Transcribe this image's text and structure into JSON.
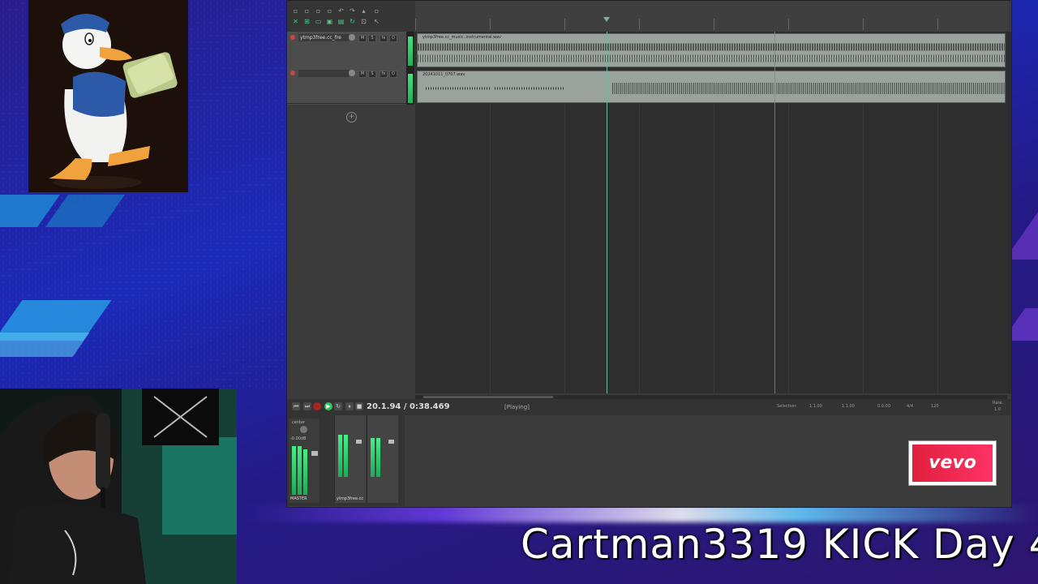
{
  "overlay": {
    "title": "Cartman3319 KICK Day 4"
  },
  "brand": {
    "logo_text": "vevo",
    "logo_color": "#e01f3d"
  },
  "daw": {
    "tracks": [
      {
        "name": "ytmp3free.cc_fre",
        "clip_title": "ytmp3free.cc_music..instrumental.wav"
      },
      {
        "name": "",
        "clip_title": "20241011_0707.wav"
      }
    ],
    "transport": {
      "time": "20.1.94 / 0:38.469",
      "status": "[Playing]",
      "selection_label": "Selection:",
      "selection_start": "1.1.00",
      "selection_end": "1.1.00",
      "selection_length": "0.0.00",
      "time_signature": "4/4",
      "bpm": "120",
      "rate_label": "Rate:",
      "rate_value": "1.0"
    },
    "mixer": {
      "master_label": "MASTER",
      "track_label": "ytmp3free.cc",
      "center_label": "center",
      "master_db": "-0.00dB"
    },
    "meter_color": "#3fe37a"
  }
}
